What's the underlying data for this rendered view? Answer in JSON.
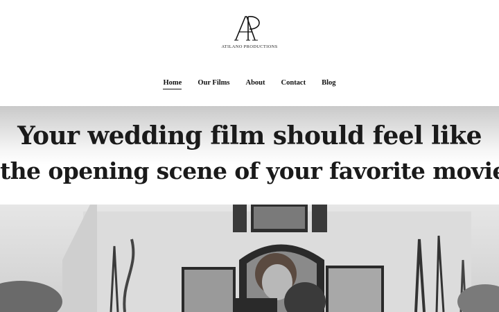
{
  "brand": {
    "monogram": "AP",
    "name": "ATILANO PRODUCTIONS"
  },
  "nav": {
    "items": [
      {
        "label": "Home",
        "active": true
      },
      {
        "label": "Our Films",
        "active": false
      },
      {
        "label": "About",
        "active": false
      },
      {
        "label": "Contact",
        "active": false
      },
      {
        "label": "Blog",
        "active": false
      }
    ]
  },
  "hero": {
    "headline_line1": "Your wedding film should feel like",
    "headline_line2": "the opening scene of your favorite movie"
  },
  "colors": {
    "text": "#111111",
    "background": "#ffffff",
    "band_top": "#c9c9c9"
  }
}
